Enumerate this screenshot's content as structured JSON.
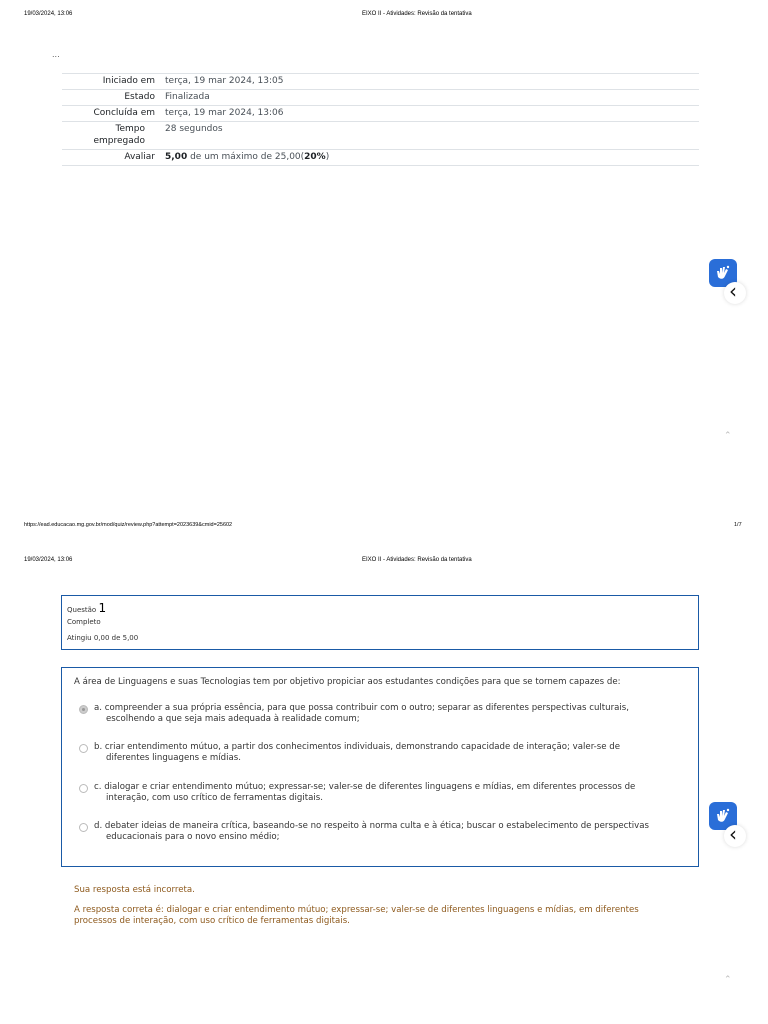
{
  "page1": {
    "header_date": "19/03/2024, 13:06",
    "header_title": "EIXO II - Atividades: Revisão da tentativa",
    "ellipsis": "...",
    "summary": [
      {
        "label": "Iniciado em",
        "value": "terça, 19 mar 2024, 13:05"
      },
      {
        "label": "Estado",
        "value": "Finalizada"
      },
      {
        "label": "Concluída em",
        "value": "terça, 19 mar 2024, 13:06"
      },
      {
        "label": "Tempo empregado",
        "value": "28 segundos"
      }
    ],
    "grade": {
      "label": "Avaliar",
      "score": "5,00",
      "mid": " de um máximo de 25,00(",
      "percent": "20%",
      "end": ")"
    },
    "footer_url": "https://ead.educacao.mg.gov.br/mod/quiz/review.php?attempt=2023639&cmid=25602",
    "footer_page": "1/7"
  },
  "page2": {
    "header_date": "19/03/2024, 13:06",
    "header_title": "EIXO II - Atividades: Revisão da tentativa",
    "question": {
      "label": "Questão",
      "number": "1",
      "state": "Completo",
      "grade": "Atingiu 0,00 de 5,00",
      "text": "A área de Linguagens e suas Tecnologias tem por objetivo propiciar aos estudantes condições para que se tornem capazes de:",
      "options": [
        {
          "letter": "a.",
          "line1": "compreender a sua própria essência, para que possa contribuir com o outro; separar as diferentes perspectivas culturais,",
          "line2": "escolhendo a que seja mais adequada à realidade comum;",
          "selected": true
        },
        {
          "letter": "b.",
          "line1": "criar entendimento mútuo, a partir dos conhecimentos individuais, demonstrando capacidade de interação; valer-se de",
          "line2": "diferentes linguagens e mídias.",
          "selected": false
        },
        {
          "letter": "c.",
          "line1": "dialogar e criar entendimento mútuo; expressar-se; valer-se de diferentes linguagens e mídias, em diferentes processos de",
          "line2": "interação, com uso crítico de ferramentas digitais.",
          "selected": false
        },
        {
          "letter": "d.",
          "line1": "debater ideias de maneira crítica, baseando-se no respeito à norma culta e à ética; buscar o estabelecimento de perspectivas",
          "line2": "educacionais para o novo ensino médio;",
          "selected": false
        }
      ],
      "feedback_incorrect": "Sua resposta está incorreta.",
      "feedback_correct_line1": "A resposta correta é: dialogar e criar entendimento mútuo; expressar-se; valer-se de diferentes linguagens e mídias, em diferentes",
      "feedback_correct_line2": "processos de interação, com uso crítico de ferramentas digitais."
    }
  },
  "icons": {
    "accessibility": "accessibility-hand-icon",
    "chevron": "chevron-left-icon",
    "caret": "caret-up-icon"
  },
  "colors": {
    "accent": "#1a5aa6",
    "feedback": "#8e5a1d",
    "vlibras": "#2a6ed8"
  }
}
